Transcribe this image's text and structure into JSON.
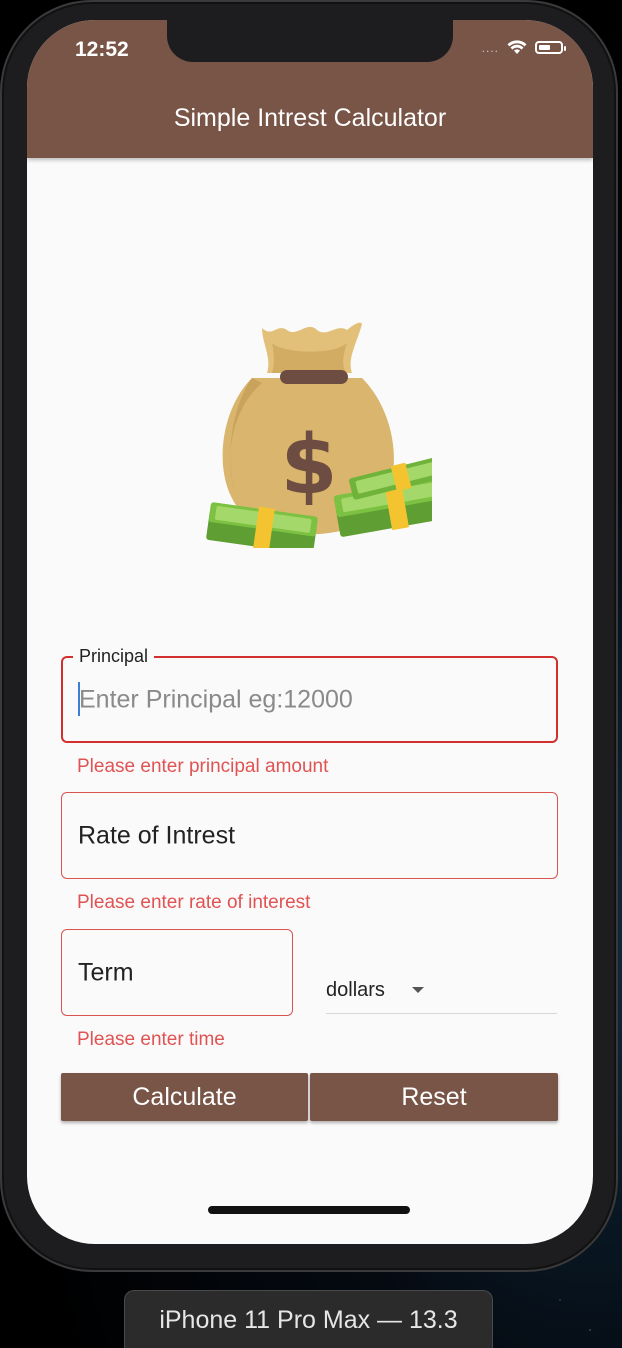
{
  "status_bar": {
    "time": "12:52",
    "signal": "....",
    "icons": [
      "wifi-icon",
      "battery-icon"
    ]
  },
  "app_bar": {
    "title": "Simple Intrest Calculator",
    "color": "#795548"
  },
  "hero": {
    "icon": "money-bag-icon"
  },
  "form": {
    "principal": {
      "label": "Principal",
      "placeholder": "Enter Principal eg:12000",
      "error": "Please enter principal amount"
    },
    "rate": {
      "label": "Rate of Intrest",
      "error": "Please enter rate of interest"
    },
    "term": {
      "label": "Term",
      "error": "Please enter time"
    },
    "currency": {
      "selected": "dollars"
    },
    "error_color": "#d32f2f"
  },
  "buttons": {
    "calculate": "Calculate",
    "reset": "Reset"
  },
  "device_caption": "iPhone 11 Pro Max — 13.3"
}
